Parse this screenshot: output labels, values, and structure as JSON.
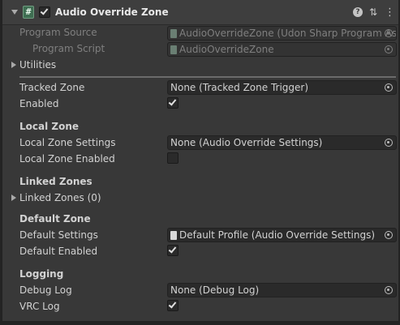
{
  "component": {
    "title": "Audio Override Zone",
    "enabled": true,
    "script_icon_glyph": "#",
    "help_glyph": "?",
    "presets_glyph": "⇅",
    "menu_glyph": "⋮"
  },
  "program": {
    "source_label": "Program Source",
    "source_value": "AudioOverrideZone (Udon Sharp Program As",
    "script_label": "Program Script",
    "script_value": "AudioOverrideZone"
  },
  "utilities_label": "Utilities",
  "fields": {
    "tracked_zone_label": "Tracked Zone",
    "tracked_zone_value": "None (Tracked Zone Trigger)",
    "enabled_label": "Enabled",
    "enabled_checked": true
  },
  "local_zone": {
    "heading": "Local Zone",
    "settings_label": "Local Zone Settings",
    "settings_value": "None (Audio Override Settings)",
    "enabled_label": "Local Zone Enabled",
    "enabled_checked": false
  },
  "linked_zones": {
    "heading": "Linked Zones",
    "foldout_label": "Linked Zones (0)"
  },
  "default_zone": {
    "heading": "Default Zone",
    "settings_label": "Default Settings",
    "settings_value": "Default Profile (Audio Override Settings)",
    "enabled_label": "Default Enabled",
    "enabled_checked": true
  },
  "logging": {
    "heading": "Logging",
    "debug_label": "Debug Log",
    "debug_value": "None (Debug Log)",
    "vrc_label": "VRC Log",
    "vrc_checked": true
  },
  "colors": {
    "background": "#383838",
    "field_bg": "#2a2a2a",
    "text": "#d2d2d2",
    "dim_text": "#7f7f7f"
  }
}
